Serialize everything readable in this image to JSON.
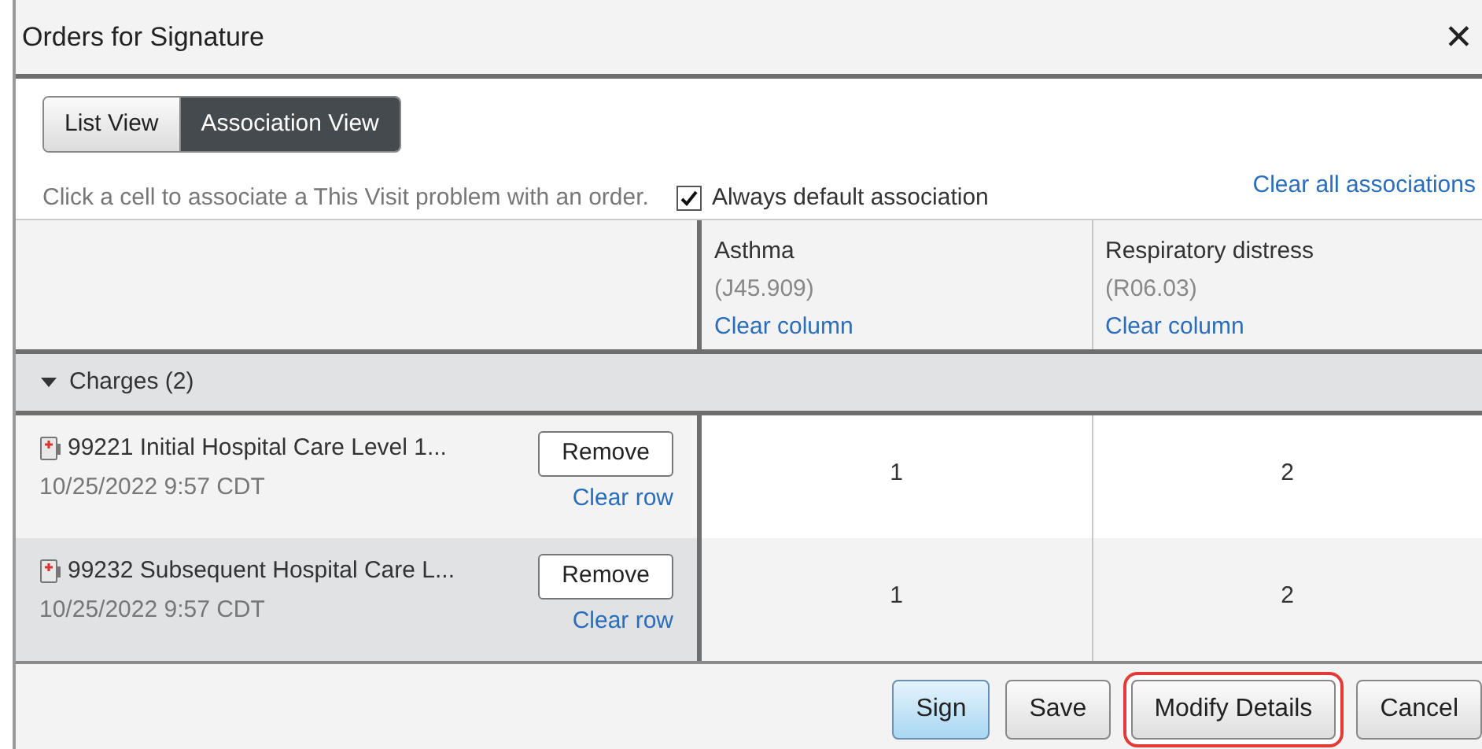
{
  "window": {
    "title": "Orders for Signature",
    "close": "✕"
  },
  "tabs": [
    {
      "label": "List View",
      "selected": false
    },
    {
      "label": "Association View",
      "selected": true
    }
  ],
  "instruction": "Click a cell to associate a This Visit problem with an order.",
  "default_association": {
    "label": "Always default association",
    "checked": true
  },
  "clear_all": "Clear all associations",
  "columns": [
    {
      "name": "Asthma",
      "code": "(J45.909)",
      "action": "Clear column"
    },
    {
      "name": "Respiratory distress",
      "code": "(R06.03)",
      "action": "Clear column"
    }
  ],
  "group": {
    "label": "Charges (2)",
    "expanded": true
  },
  "rows": [
    {
      "order": "99221 Initial Hospital Care Level 1...",
      "time": "10/25/2022 9:57 CDT",
      "remove": "Remove",
      "clear": "Clear row",
      "selected": false,
      "cells": [
        "1",
        "2"
      ]
    },
    {
      "order": "99232 Subsequent Hospital Care L...",
      "time": "10/25/2022 9:57 CDT",
      "remove": "Remove",
      "clear": "Clear row",
      "selected": true,
      "cells": [
        "1",
        "2"
      ]
    }
  ],
  "buttons": [
    {
      "label": "Sign",
      "kind": "primary",
      "highlighted": false
    },
    {
      "label": "Save",
      "kind": "normal",
      "highlighted": false
    },
    {
      "label": "Modify Details",
      "kind": "normal",
      "highlighted": true
    },
    {
      "label": "Cancel",
      "kind": "normal",
      "highlighted": false
    }
  ]
}
